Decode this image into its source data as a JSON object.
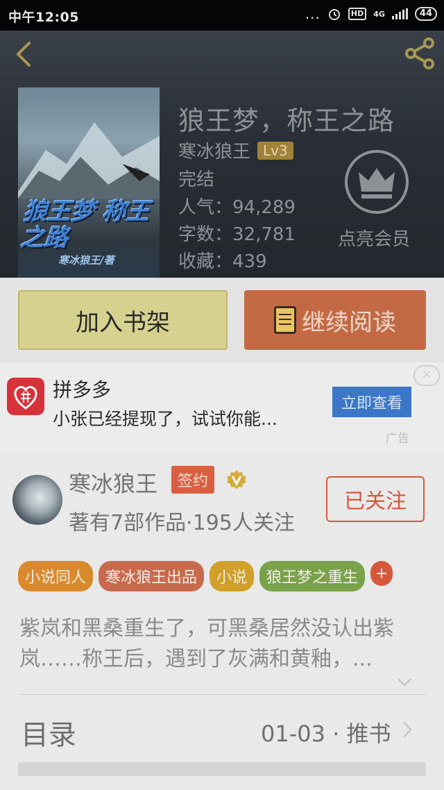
{
  "status_bar": {
    "time": "中午12:05",
    "dots": "...",
    "network": "HD",
    "network_type": "4G",
    "battery": "44"
  },
  "header": {
    "back_icon": "chevron-left-icon",
    "share_icon": "share-icon"
  },
  "book": {
    "title": "狼王梦，称王之路",
    "author": "寒冰狼王",
    "level": "Lv3",
    "status": "完结",
    "popularity": "人气：94,289",
    "word_count": "字数：32,781",
    "favorites": "收藏：439",
    "cover_title": "狼王梦 称王之路",
    "cover_author": "寒冰狼王/著"
  },
  "vip": {
    "label": "点亮会员",
    "icon": "crown-icon"
  },
  "actions": {
    "add_shelf": "加入书架",
    "continue_read": "继续阅读"
  },
  "ad": {
    "title": "拼多多",
    "description": "小张已经提现了，试试你能...",
    "button": "立即查看",
    "tag": "广告",
    "close": "×"
  },
  "author_card": {
    "name": "寒冰狼王",
    "badge": "签约",
    "meta": "著有7部作品·195人关注",
    "follow": "已关注"
  },
  "tags": [
    {
      "label": "小说同人",
      "color": "#d98a2c"
    },
    {
      "label": "寒冰狼王出品",
      "color": "#c86a4e"
    },
    {
      "label": "小说",
      "color": "#d0a02a"
    },
    {
      "label": "狼王梦之重生",
      "color": "#7aa24a"
    }
  ],
  "tag_more": "+",
  "synopsis": "紫岚和黑桑重生了，可黑桑居然没认出紫岚……称王后，遇到了灰满和黄釉，...",
  "toc": {
    "title": "目录",
    "latest": "01-03 · 推书"
  },
  "colors": {
    "accent": "#d6583a",
    "shelf_button": "#d6d18f",
    "read_button": "#c36a45",
    "ad_button": "#3b77c6"
  }
}
